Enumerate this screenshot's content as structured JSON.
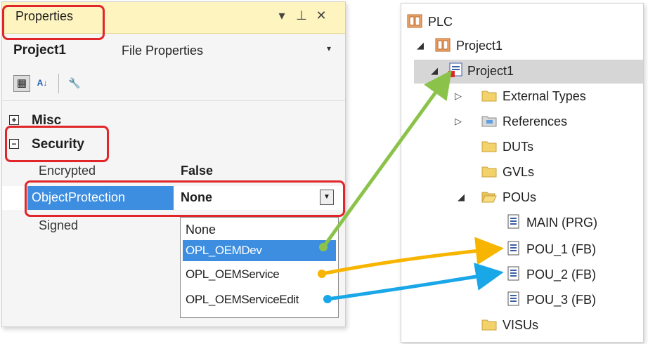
{
  "properties_panel": {
    "title": "Properties",
    "title_buttons": {
      "dropdown": "▾",
      "pin": "⊥",
      "close": "✕"
    },
    "object_name": "Project1",
    "object_type": "File Properties",
    "object_dropdown": "▾",
    "toolbar": {
      "categorized": "▦",
      "alphabetical": "A↓",
      "property_pages": "🔧"
    },
    "groups": [
      {
        "label": "Misc",
        "expander": "+",
        "expanded": false
      },
      {
        "label": "Security",
        "expander": "−",
        "expanded": true
      }
    ],
    "properties": [
      {
        "name": "Encrypted",
        "value": "False"
      },
      {
        "name": "ObjectProtection",
        "value": "None"
      },
      {
        "name": "Signed",
        "value": ""
      }
    ],
    "combo_arrow": "▼",
    "dropdown_options": [
      "None",
      "OPL_OEMDev",
      "OPL_OEMService",
      "OPL_OEMServiceEdit"
    ],
    "dropdown_selected": "OPL_OEMDev"
  },
  "tree": {
    "items": [
      {
        "label": "PLC",
        "icon": "plc-icon"
      },
      {
        "label": "Project1",
        "icon": "plc-project-icon",
        "expander": "◢"
      },
      {
        "label": "Project1",
        "icon": "project-icon",
        "expander": "◢",
        "selected": true
      },
      {
        "label": "External Types",
        "icon": "folder-icon",
        "expander": "▷"
      },
      {
        "label": "References",
        "icon": "references-icon",
        "expander": "▷"
      },
      {
        "label": "DUTs",
        "icon": "folder-icon"
      },
      {
        "label": "GVLs",
        "icon": "folder-icon"
      },
      {
        "label": "POUs",
        "icon": "folder-open-icon",
        "expander": "◢"
      },
      {
        "label": "MAIN (PRG)",
        "icon": "pou-icon"
      },
      {
        "label": "POU_1 (FB)",
        "icon": "pou-icon"
      },
      {
        "label": "POU_2 (FB)",
        "icon": "pou-icon"
      },
      {
        "label": "POU_3 (FB)",
        "icon": "pou-icon"
      },
      {
        "label": "VISUs",
        "icon": "folder-icon"
      }
    ]
  },
  "colors": {
    "title_bg": "#fdf4bf",
    "selection_blue": "#3d8ee0",
    "highlight_red": "#e0262a",
    "arrow_green": "#8bc34a",
    "arrow_orange": "#f7b500",
    "arrow_blue": "#1aa7e8",
    "folder_yellow": "#f3d26b"
  }
}
